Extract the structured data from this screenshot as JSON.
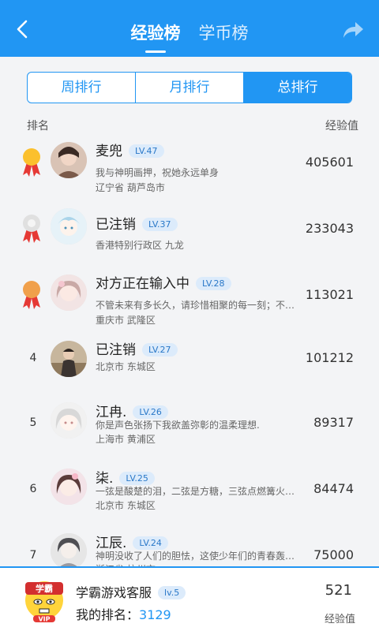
{
  "header": {
    "tabs": [
      {
        "label": "经验榜",
        "active": true
      },
      {
        "label": "学币榜",
        "active": false
      }
    ],
    "back_icon": "chevron-left-icon",
    "share_icon": "share-arrow-icon",
    "accent_color": "#2196f3"
  },
  "period_tabs": [
    {
      "label": "周排行",
      "active": false
    },
    {
      "label": "月排行",
      "active": false
    },
    {
      "label": "总排行",
      "active": true
    }
  ],
  "columns": {
    "rank": "排名",
    "score": "经验值"
  },
  "rows": [
    {
      "rank": "1",
      "medal": "gold",
      "name": "麦兜",
      "level": "LV.47",
      "signature": "我与神明画押，祝她永远单身",
      "location": "辽宁省 葫芦岛市",
      "score": "405601"
    },
    {
      "rank": "2",
      "medal": "silver",
      "name": "已注销",
      "level": "LV.37",
      "signature": "",
      "location": "香港特别行政区 九龙",
      "score": "233043"
    },
    {
      "rank": "3",
      "medal": "bronze",
      "name": "对方正在输入中",
      "level": "LV.28",
      "signature": "不管未来有多长久，请珍惜相聚的每一刻；不管…",
      "location": "重庆市 武隆区",
      "score": "113021"
    },
    {
      "rank": "4",
      "medal": "",
      "name": "已注销",
      "level": "LV.27",
      "signature": "",
      "location": "北京市 东城区",
      "score": "101212"
    },
    {
      "rank": "5",
      "medal": "",
      "name": "江冉.",
      "level": "LV.26",
      "signature": "你是声色张扬下我欲盖弥彰的温柔理想.",
      "location": "上海市 黄浦区",
      "score": "89317"
    },
    {
      "rank": "6",
      "medal": "",
      "name": "柒.",
      "level": "LV.25",
      "signature": "一弦是酸楚的泪，二弦是方糖，三弦点燃篝火，四…",
      "location": "北京市 东城区",
      "score": "84474"
    },
    {
      "rank": "7",
      "medal": "",
      "name": "江辰.",
      "level": "LV.24",
      "signature": "神明没收了人们的胆怯，这使少年们的青春轰轰烈…",
      "location": "浙江省 杭州市",
      "score": "75000"
    }
  ],
  "me": {
    "name": "学霸游戏客服",
    "level": "lv.5",
    "rank_label": "我的排名：",
    "rank_value": "3129",
    "score": "521",
    "score_label": "经验值",
    "avatar_text": "学霸",
    "vip_text": "VIP"
  }
}
